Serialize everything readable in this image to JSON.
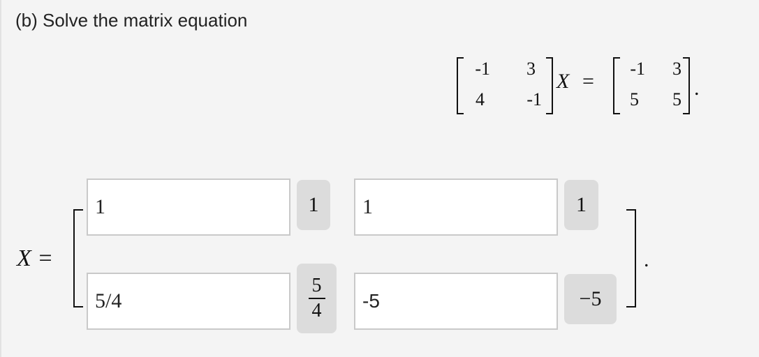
{
  "prompt": "(b) Solve the matrix equation",
  "equation": {
    "A": [
      [
        "-1",
        "3"
      ],
      [
        "4",
        "-1"
      ]
    ],
    "variable": "X",
    "equals": "=",
    "B": [
      [
        "-1",
        "3"
      ],
      [
        "5",
        "5"
      ]
    ],
    "period": "."
  },
  "answer": {
    "label": "X =",
    "period": ".",
    "cells": [
      {
        "input": "1",
        "preview": "1"
      },
      {
        "input": "1",
        "preview": "1"
      },
      {
        "input": "5/4",
        "preview_num": "5",
        "preview_den": "4"
      },
      {
        "input": "-5",
        "preview": "−5"
      }
    ]
  }
}
